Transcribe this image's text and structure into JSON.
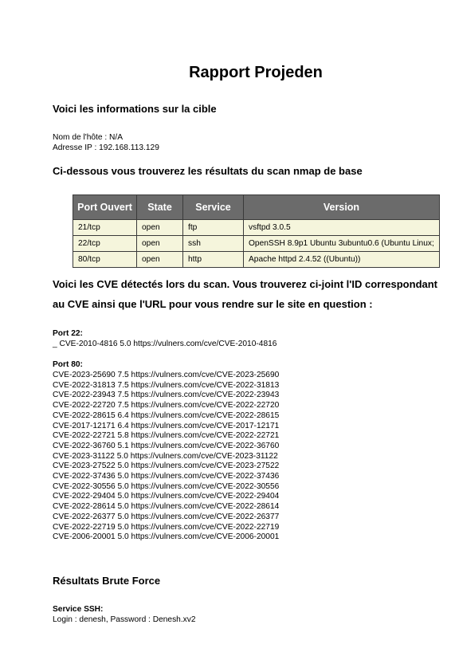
{
  "report": {
    "title": "Rapport Projeden",
    "target_heading": "Voici les informations sur la cible",
    "hostname_line": "Nom de l'hôte : N/A",
    "ip_line": "Adresse IP : 192.168.113.129",
    "nmap_heading": "Ci-dessous vous trouverez les résultats du scan nmap de base",
    "cve_heading_line1": "Voici les CVE détectés lors du scan. Vous trouverez ci-joint l'ID correspondant",
    "cve_heading_line2": "au CVE ainsi que l'URL pour vous rendre sur le site en question :",
    "port22_label": "Port 22:",
    "port22_cves": [
      "_ CVE-2010-4816 5.0 https://vulners.com/cve/CVE-2010-4816"
    ],
    "port80_label": "Port 80:",
    "port80_cves": [
      "CVE-2023-25690 7.5 https://vulners.com/cve/CVE-2023-25690",
      "CVE-2022-31813 7.5 https://vulners.com/cve/CVE-2022-31813",
      "CVE-2022-23943 7.5 https://vulners.com/cve/CVE-2022-23943",
      "CVE-2022-22720 7.5 https://vulners.com/cve/CVE-2022-22720",
      "CVE-2022-28615 6.4 https://vulners.com/cve/CVE-2022-28615",
      "CVE-2017-12171 6.4 https://vulners.com/cve/CVE-2017-12171",
      "CVE-2022-22721 5.8 https://vulners.com/cve/CVE-2022-22721",
      "CVE-2022-36760 5.1 https://vulners.com/cve/CVE-2022-36760",
      "CVE-2023-31122 5.0 https://vulners.com/cve/CVE-2023-31122",
      "CVE-2023-27522 5.0 https://vulners.com/cve/CVE-2023-27522",
      "CVE-2022-37436 5.0 https://vulners.com/cve/CVE-2022-37436",
      "CVE-2022-30556 5.0 https://vulners.com/cve/CVE-2022-30556",
      "CVE-2022-29404 5.0 https://vulners.com/cve/CVE-2022-29404",
      "CVE-2022-28614 5.0 https://vulners.com/cve/CVE-2022-28614",
      "CVE-2022-26377 5.0 https://vulners.com/cve/CVE-2022-26377",
      "CVE-2022-22719 5.0 https://vulners.com/cve/CVE-2022-22719",
      "CVE-2006-20001 5.0 https://vulners.com/cve/CVE-2006-20001"
    ],
    "bruteforce_heading": "Résultats Brute Force",
    "ssh_service_label": "Service SSH:",
    "ssh_credentials": "Login : denesh, Password : Denesh.xv2"
  },
  "ports_table": {
    "headers": [
      "Port Ouvert",
      "State",
      "Service",
      "Version"
    ],
    "rows": [
      [
        "21/tcp",
        "open",
        "ftp",
        "vsftpd 3.0.5"
      ],
      [
        "22/tcp",
        "open",
        "ssh",
        "OpenSSH 8.9p1 Ubuntu 3ubuntu0.6 (Ubuntu Linux;"
      ],
      [
        "80/tcp",
        "open",
        "http",
        "Apache httpd 2.4.52 ((Ubuntu))"
      ]
    ],
    "header_bg": "#6b6b6b",
    "cell_bg": "#f5f5dc"
  }
}
